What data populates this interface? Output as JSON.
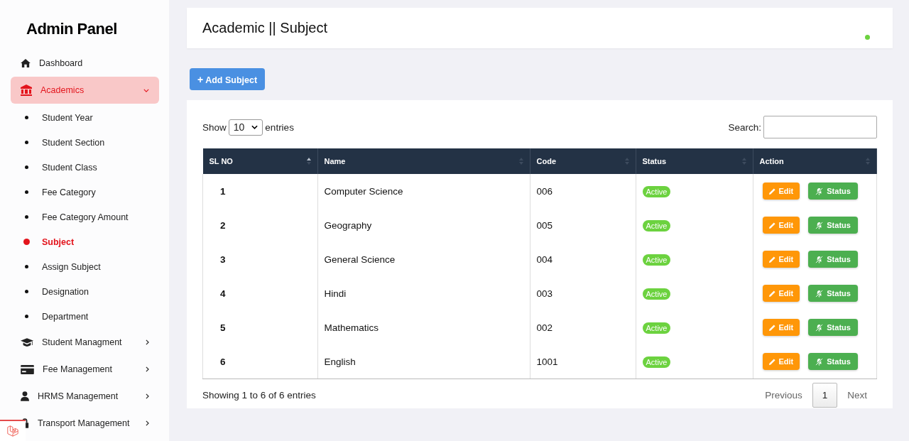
{
  "sidebar": {
    "title": "Admin Panel",
    "items": [
      {
        "label": "Dashboard",
        "selected": false
      },
      {
        "label": "Academics",
        "selected": true,
        "expanded": true,
        "children": [
          {
            "label": "Student Year",
            "selected": false
          },
          {
            "label": "Student Section",
            "selected": false
          },
          {
            "label": "Student Class",
            "selected": false
          },
          {
            "label": "Fee Category",
            "selected": false
          },
          {
            "label": "Fee Category Amount",
            "selected": false
          },
          {
            "label": "Subject",
            "selected": true
          },
          {
            "label": "Assign Subject",
            "selected": false
          },
          {
            "label": "Designation",
            "selected": false
          },
          {
            "label": "Department",
            "selected": false
          }
        ]
      },
      {
        "label": "Student Managment",
        "selected": false,
        "expanded": false
      },
      {
        "label": "Fee Management",
        "selected": false,
        "expanded": false
      },
      {
        "label": "HRMS Management",
        "selected": false,
        "expanded": false
      },
      {
        "label": "Transport Management",
        "selected": false,
        "expanded": false
      }
    ]
  },
  "header": {
    "title": "Academic || Subject"
  },
  "add_button": {
    "icon": "+",
    "label": "Add Subject"
  },
  "table_controls": {
    "show_label": "Show",
    "page_size": "10",
    "entries_label": "entries",
    "search_label": "Search:"
  },
  "table": {
    "columns": [
      {
        "label": "SL NO",
        "sorted": true
      },
      {
        "label": "Name",
        "sorted": false
      },
      {
        "label": "Code",
        "sorted": false
      },
      {
        "label": "Status",
        "sorted": false
      },
      {
        "label": "Action",
        "sorted": false
      }
    ],
    "rows": [
      {
        "sl": "1",
        "name": "Computer Science",
        "code": "006",
        "status": "Active",
        "edit": "Edit",
        "toggle": "Status"
      },
      {
        "sl": "2",
        "name": "Geography",
        "code": "005",
        "status": "Active",
        "edit": "Edit",
        "toggle": "Status"
      },
      {
        "sl": "3",
        "name": "General Science",
        "code": "004",
        "status": "Active",
        "edit": "Edit",
        "toggle": "Status"
      },
      {
        "sl": "4",
        "name": "Hindi",
        "code": "003",
        "status": "Active",
        "edit": "Edit",
        "toggle": "Status"
      },
      {
        "sl": "5",
        "name": "Mathematics",
        "code": "002",
        "status": "Active",
        "edit": "Edit",
        "toggle": "Status"
      },
      {
        "sl": "6",
        "name": "English",
        "code": "1001",
        "status": "Active",
        "edit": "Edit",
        "toggle": "Status"
      }
    ]
  },
  "footer": {
    "info": "Showing 1 to 6 of 6 entries",
    "pagination": {
      "previous": "Previous",
      "pages": [
        {
          "label": "1",
          "selected": true
        }
      ],
      "next": "Next"
    }
  }
}
